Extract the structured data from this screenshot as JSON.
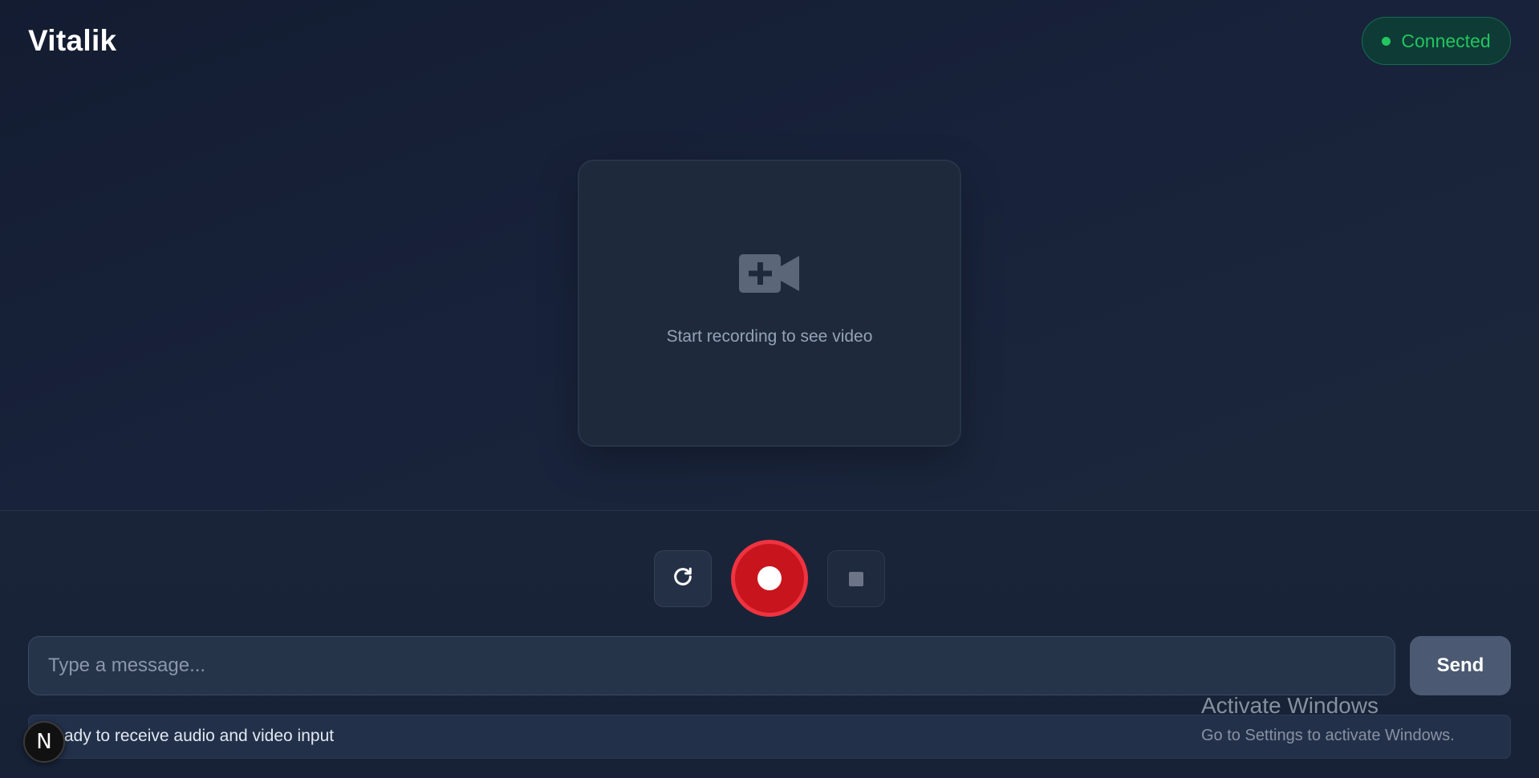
{
  "header": {
    "title": "Vitalik",
    "connection_status": "Connected",
    "status_color": "#22c55e"
  },
  "video": {
    "icon": "video-plus-icon",
    "placeholder": "Start recording to see video"
  },
  "controls": {
    "refresh_icon": "refresh-icon",
    "record_icon": "record-icon",
    "stop_icon": "stop-icon",
    "record_color": "#dc2626"
  },
  "composer": {
    "placeholder": "Type a message...",
    "value": "",
    "send_label": "Send"
  },
  "status_bar": {
    "message": "Ready to receive audio and video input"
  },
  "dev_badge": {
    "label": "N"
  },
  "watermark": {
    "title": "Activate Windows",
    "subtitle": "Go to Settings to activate Windows."
  }
}
